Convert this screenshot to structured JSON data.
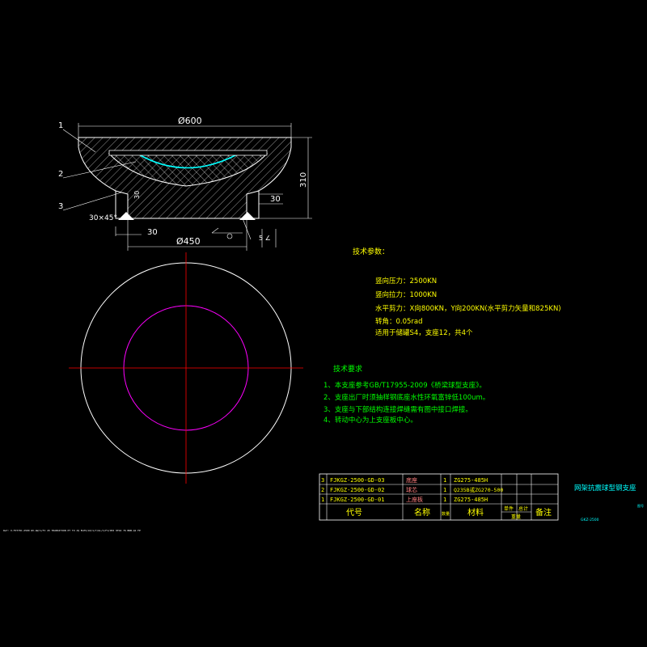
{
  "colors": {
    "background": "#000000",
    "line": "#ffffff",
    "text_param": "#ffff00",
    "text_req": "#00ff00",
    "table_text": "#ffff00",
    "table_name": "#ff8080",
    "title_text": "#00ffff",
    "center_line": "#ff0000",
    "inner_circle": "#ff00ff",
    "spherical_face": "#00ffff"
  },
  "section": {
    "dims": {
      "top_dia": "Ø600",
      "bottom_dia": "Ø450",
      "height": "310",
      "chamfer": "30×45°",
      "left_30": "30",
      "right_30": "30",
      "small_dim": "30"
    },
    "leaders": [
      "1",
      "2",
      "3"
    ]
  },
  "params": {
    "title": "技术参数：",
    "lines": [
      "竖向压力：2500KN",
      "竖向拉力：1000KN",
      "水平剪力：X向800KN，Y向200KN(水平剪力矢量和825KN)",
      "转角：0.05rad",
      "适用于储罐S4，支座12，共4个"
    ]
  },
  "requirements": {
    "title": "技术要求",
    "lines": [
      "1、本支座参考GB/T17955-2009《桥梁球型支座》。",
      "2、支座出厂时须抽样钢底座水性环氧富锌低100um。",
      "3、支座与下部结构连接焊缝需有图中接口焊接。",
      "4、转动中心为上支座板中心。"
    ]
  },
  "table": {
    "rows": [
      {
        "no": "3",
        "code": "FJKGZ-2500-GD-03",
        "name": "底座",
        "qty": "1",
        "material": "ZG275-485H"
      },
      {
        "no": "2",
        "code": "FJKGZ-2500-GD-02",
        "name": "球芯",
        "qty": "1",
        "material": "Q235B或ZG270-500"
      },
      {
        "no": "1",
        "code": "FJKGZ-2500-GD-01",
        "name": "上座板",
        "qty": "1",
        "material": "ZG275-485H"
      }
    ],
    "header": {
      "code": "代号",
      "name": "名称",
      "qty": "数量",
      "material": "材料",
      "unit_weight": "单件",
      "total_weight": "总计",
      "weight": "重量",
      "remarks": "备注"
    }
  },
  "title_block": {
    "name": "网架抗震球型钢支座",
    "sheet": "图号",
    "sub": "GKZ-2500"
  },
  "footer_note": "Ref: X-FXT70C-2500 WI-GW/1/FJ 45 TRANSITION PT TO JQ ELEV/LK/1/7/GL/1/FJ/OHJ 9TOA 76 BRB-Q1 FP"
}
